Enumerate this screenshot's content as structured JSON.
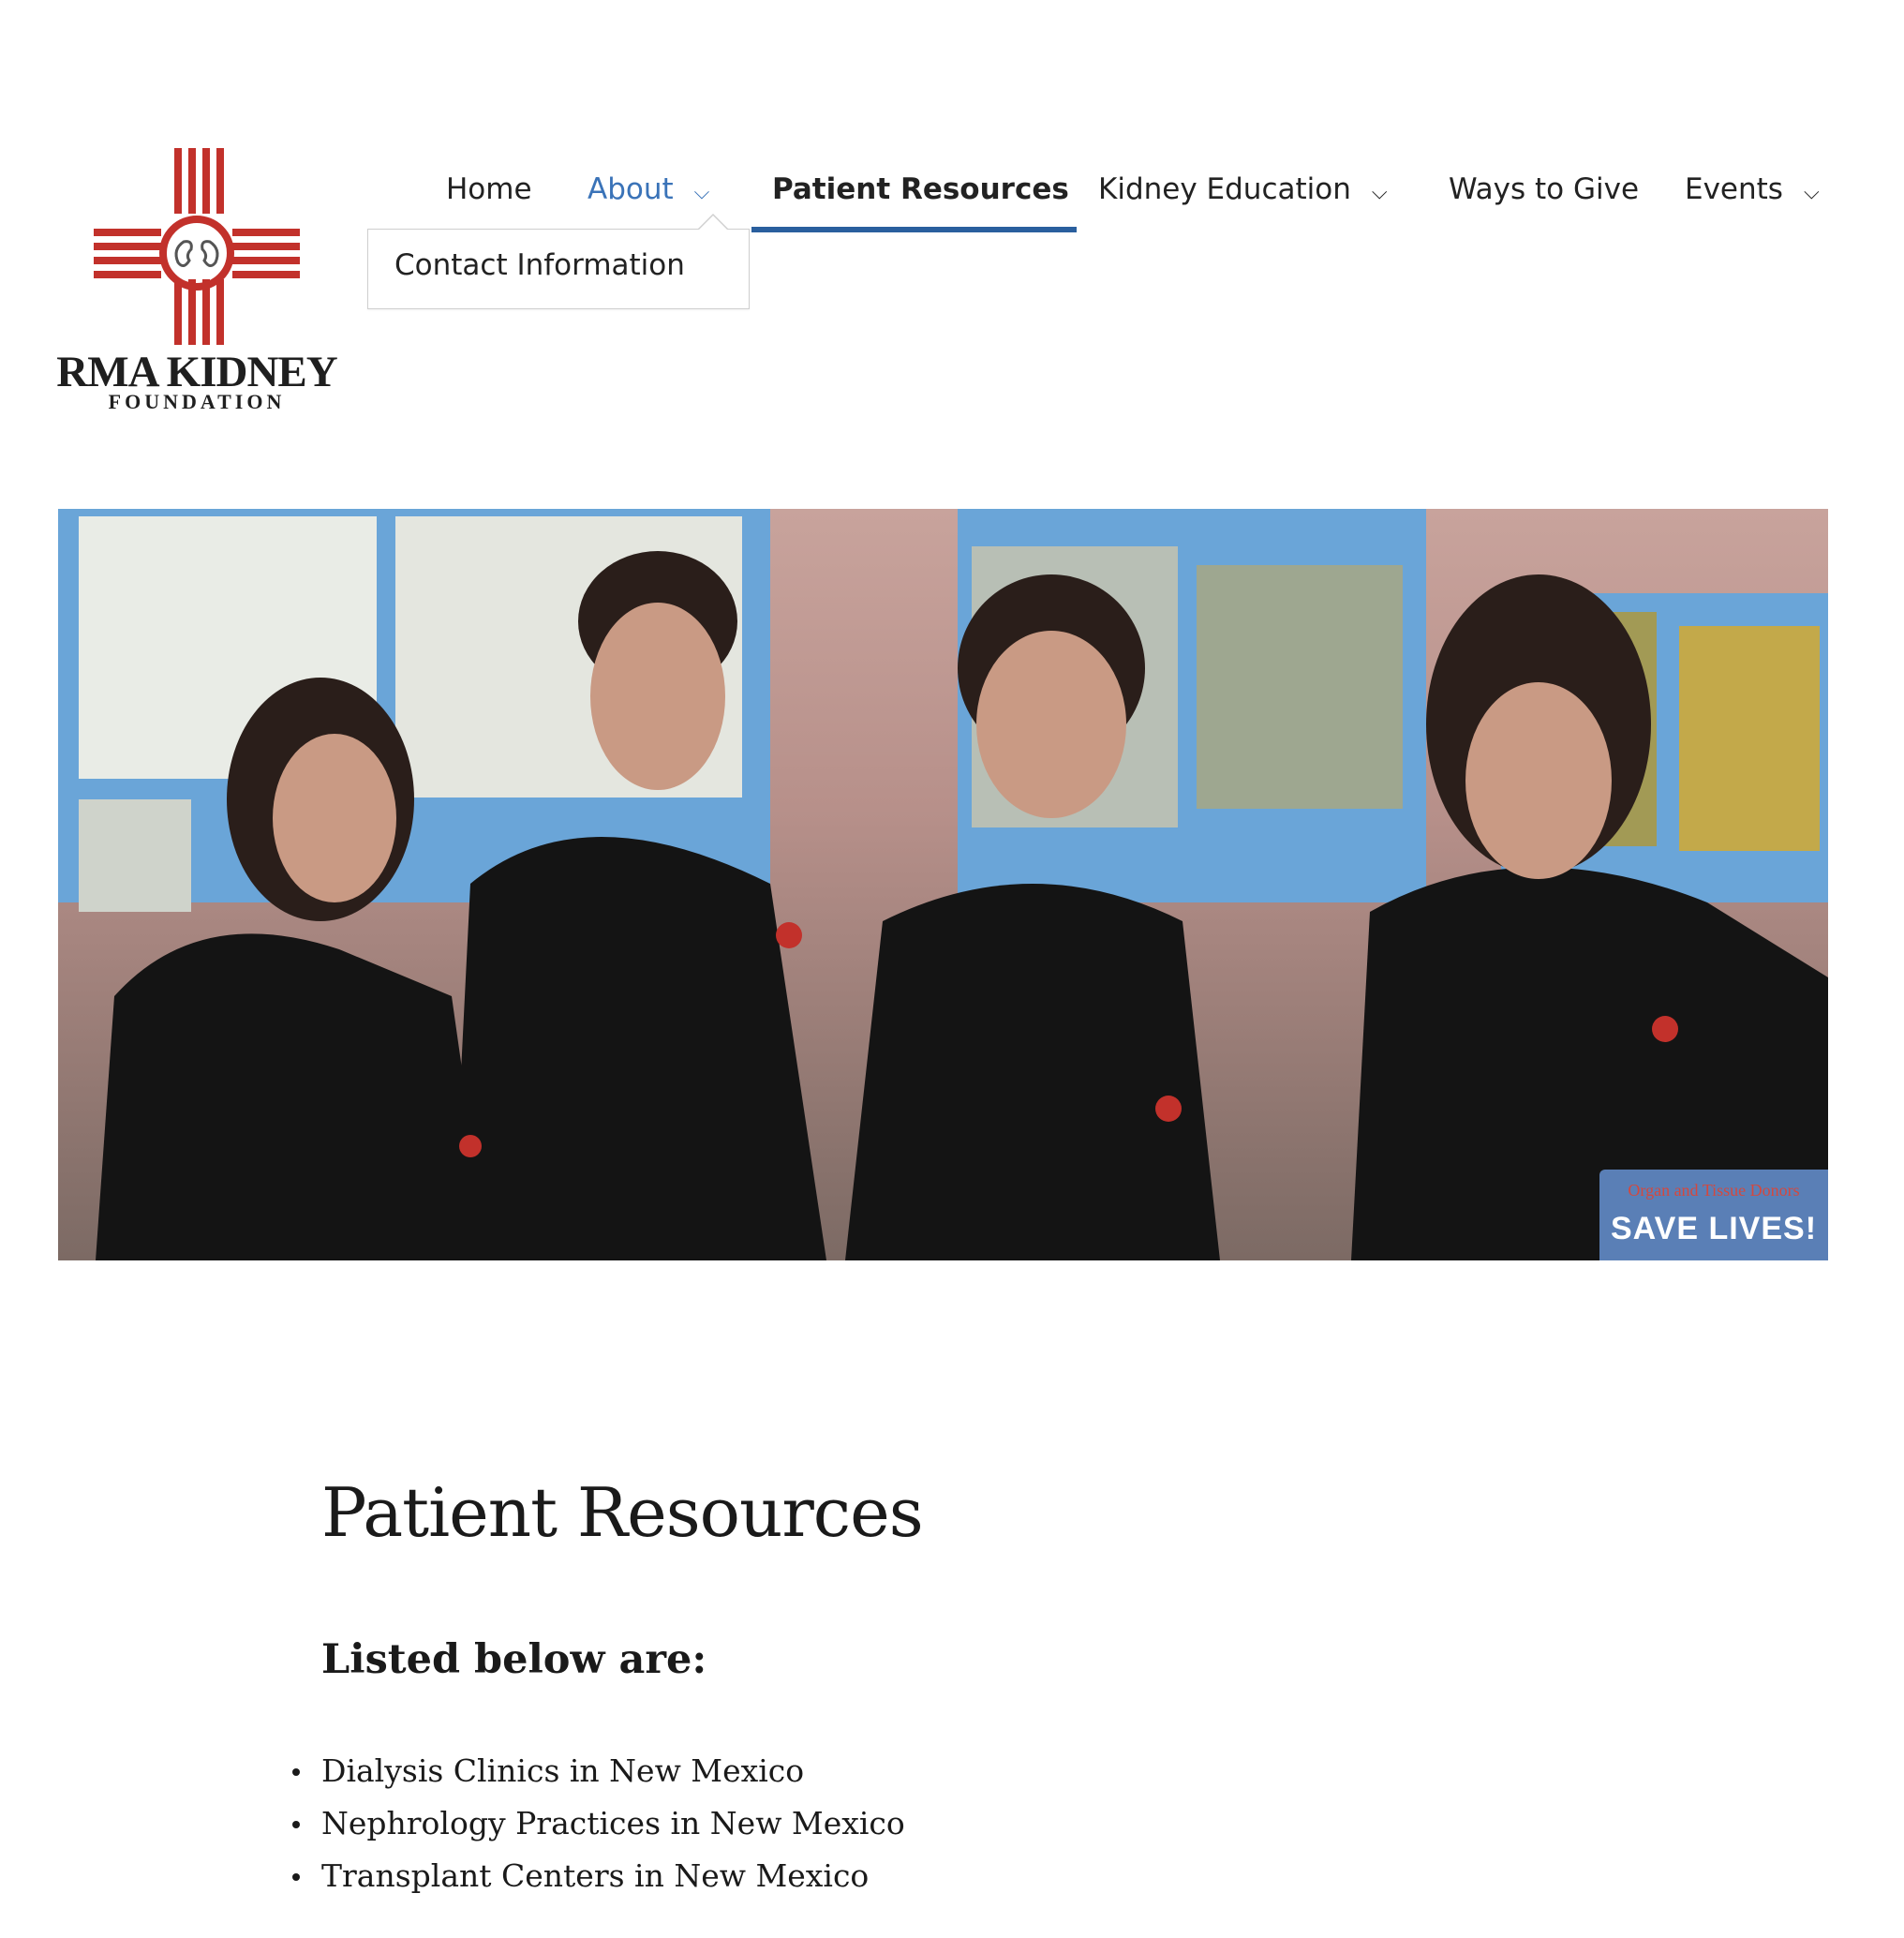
{
  "logo": {
    "line1": "RMA KIDNEY",
    "line2": "FOUNDATION",
    "colors": {
      "zia": "#c2312b",
      "text": "#1f1f1f"
    }
  },
  "nav": {
    "items": [
      {
        "label": "Home",
        "has_dropdown": false
      },
      {
        "label": "About",
        "has_dropdown": true,
        "state": "hover"
      },
      {
        "label": "Patient Resources",
        "has_dropdown": false,
        "state": "current"
      },
      {
        "label": "Kidney Education",
        "has_dropdown": true
      },
      {
        "label": "Ways to Give",
        "has_dropdown": true
      },
      {
        "label": "Events",
        "has_dropdown": true
      }
    ],
    "dropdown_icon": "chevron-down-icon",
    "colors": {
      "hover": "#3a73b8",
      "current_underline": "#2a5f9e"
    }
  },
  "about_dropdown": {
    "items": [
      {
        "label": "Contact Information"
      }
    ]
  },
  "hero": {
    "sign_text_top": "Organ and Tissue Donors",
    "sign_text_main": "SAVE LIVES!"
  },
  "content": {
    "title": "Patient Resources",
    "subheading": "Listed below are:",
    "list": [
      "Dialysis Clinics in New Mexico",
      "Nephrology Practices in New Mexico",
      "Transplant Centers in New Mexico"
    ]
  }
}
